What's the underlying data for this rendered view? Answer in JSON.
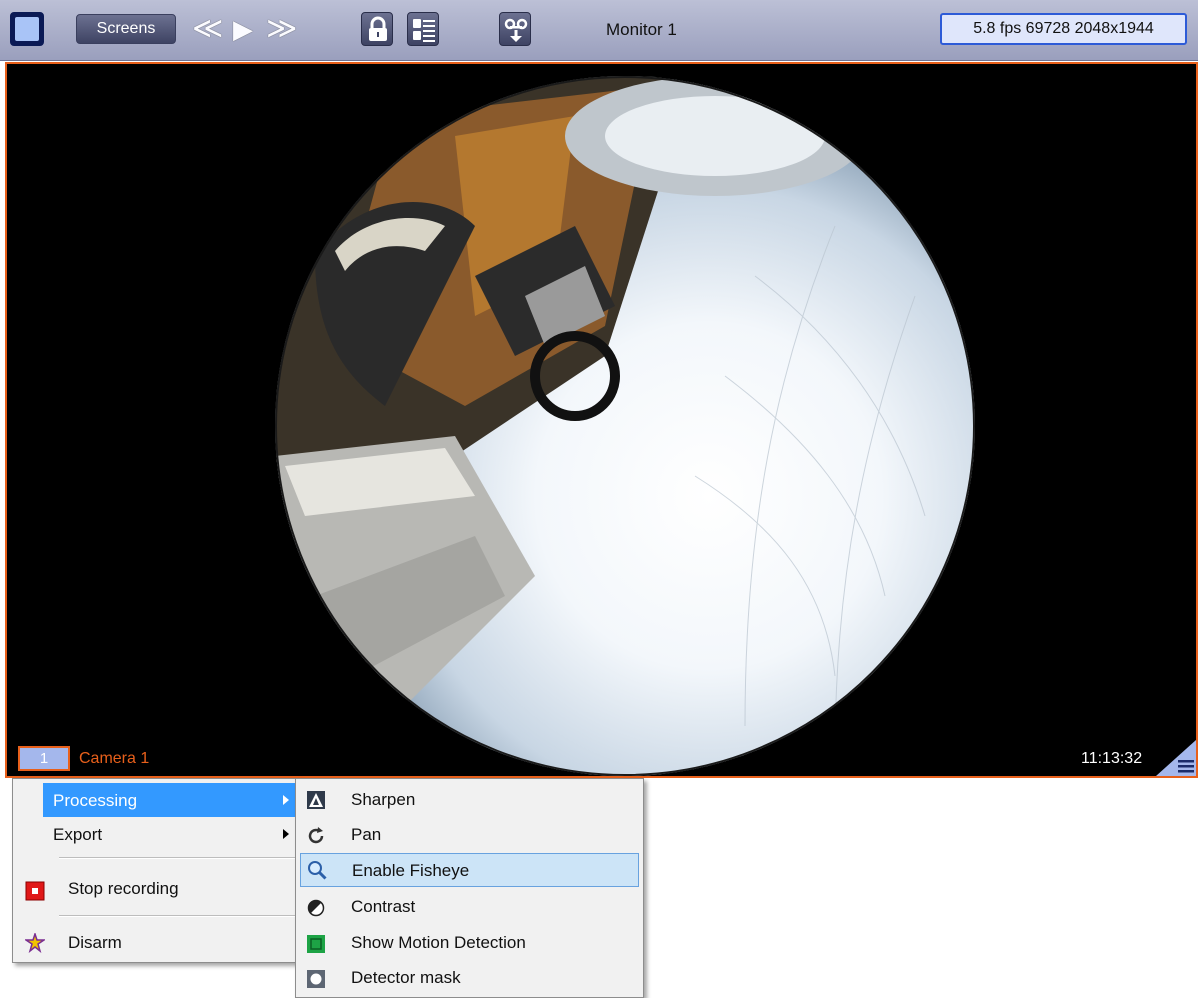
{
  "toolbar": {
    "screens_label": "Screens",
    "prev_symbol": "≪",
    "play_symbol": "▶",
    "next_symbol": "≫",
    "monitor_title": "Monitor 1",
    "stats": "5.8 fps  69728 2048x1944",
    "icons": [
      "layout-square-icon",
      "lock-icon",
      "event-list-icon",
      "voicemail-icon"
    ]
  },
  "video": {
    "camera_number": "1",
    "camera_name": "Camera 1",
    "time": "11:13:32",
    "frame_color": "#e8601b"
  },
  "context_menu": {
    "items": [
      {
        "label": "Processing",
        "submenu": true,
        "highlighted": true
      },
      {
        "label": "Export",
        "submenu": true
      },
      {
        "label": "Stop recording",
        "icon": "stop-recording-icon"
      },
      {
        "label": "Disarm",
        "icon": "disarm-icon"
      }
    ]
  },
  "processing_submenu": {
    "items": [
      {
        "label": "Sharpen",
        "icon": "sharpen-icon"
      },
      {
        "label": "Pan",
        "icon": "pan-icon"
      },
      {
        "label": "Enable Fisheye",
        "icon": "magnifier-icon",
        "highlighted": true
      },
      {
        "label": "Contrast",
        "icon": "contrast-icon"
      },
      {
        "label": "Show Motion Detection",
        "icon": "motion-detection-icon"
      },
      {
        "label": "Detector mask",
        "icon": "detector-mask-icon"
      }
    ]
  }
}
